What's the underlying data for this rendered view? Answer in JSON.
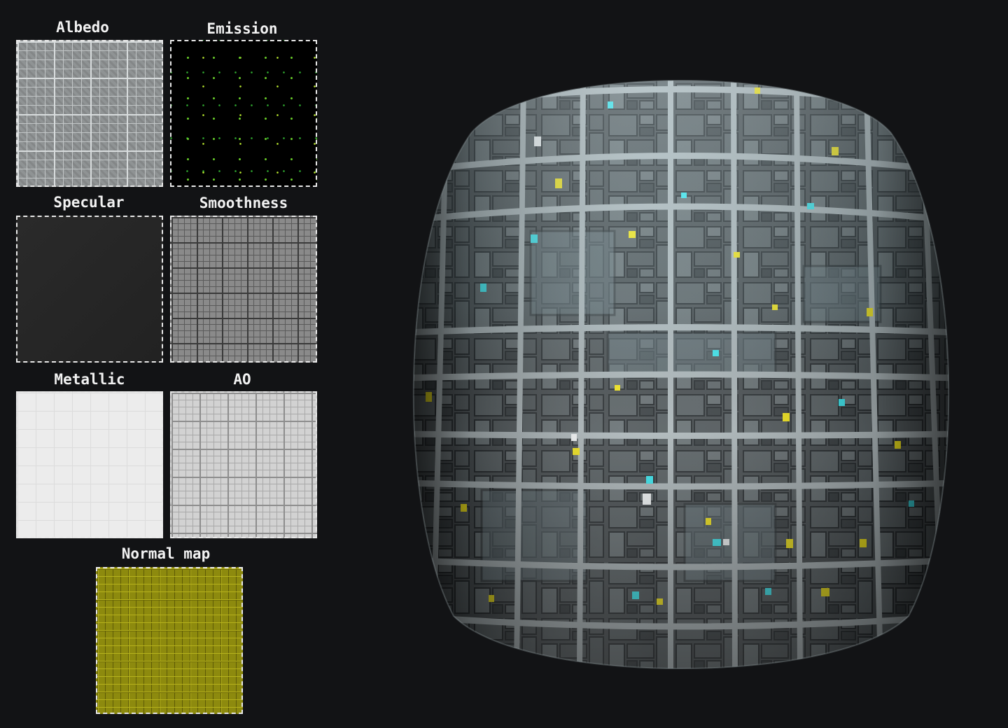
{
  "maps": [
    {
      "id": "albedo",
      "label": "Albedo"
    },
    {
      "id": "emission",
      "label": "Emission"
    },
    {
      "id": "specular",
      "label": "Specular"
    },
    {
      "id": "smoothness",
      "label": "Smoothness"
    },
    {
      "id": "metallic",
      "label": "Metallic"
    },
    {
      "id": "ao",
      "label": "AO"
    },
    {
      "id": "normal",
      "label": "Normal map"
    }
  ],
  "colors": {
    "background": "#121315",
    "label_text": "#f2f2f2",
    "tile_border": "#e8e8e8",
    "emission_yellow": "#f5e81e",
    "emission_cyan": "#3ee8f0",
    "panel_metal": "#5c6467"
  }
}
